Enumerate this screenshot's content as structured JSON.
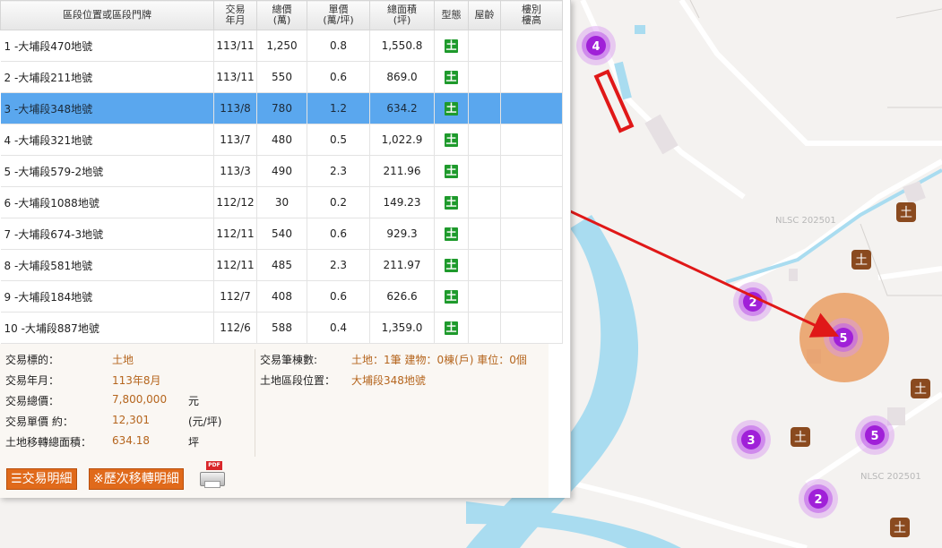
{
  "table": {
    "headers": {
      "address": "區段位置或區段門牌",
      "date_line1": "交易",
      "date_line2": "年月",
      "total_line1": "總價",
      "total_line2": "(萬)",
      "unit_line1": "單價",
      "unit_line2": "(萬/坪)",
      "area_line1": "總面積",
      "area_line2": "(坪)",
      "type": "型態",
      "age": "屋齡",
      "floor_line1": "樓別",
      "floor_line2": "樓高"
    },
    "rows": [
      {
        "address": "1 -大埔段470地號",
        "date": "113/11",
        "total": "1,250",
        "unit": "0.8",
        "area": "1,550.8",
        "type": "土"
      },
      {
        "address": "2 -大埔段211地號",
        "date": "113/11",
        "total": "550",
        "unit": "0.6",
        "area": "869.0",
        "type": "土"
      },
      {
        "address": "3 -大埔段348地號",
        "date": "113/8",
        "total": "780",
        "unit": "1.2",
        "area": "634.2",
        "type": "土"
      },
      {
        "address": "4 -大埔段321地號",
        "date": "113/7",
        "total": "480",
        "unit": "0.5",
        "area": "1,022.9",
        "type": "土"
      },
      {
        "address": "5 -大埔段579-2地號",
        "date": "113/3",
        "total": "490",
        "unit": "2.3",
        "area": "211.96",
        "type": "土"
      },
      {
        "address": "6 -大埔段1088地號",
        "date": "112/12",
        "total": "30",
        "unit": "0.2",
        "area": "149.23",
        "type": "土"
      },
      {
        "address": "7 -大埔段674-3地號",
        "date": "112/11",
        "total": "540",
        "unit": "0.6",
        "area": "929.3",
        "type": "土"
      },
      {
        "address": "8 -大埔段581地號",
        "date": "112/11",
        "total": "485",
        "unit": "2.3",
        "area": "211.97",
        "type": "土"
      },
      {
        "address": "9 -大埔段184地號",
        "date": "112/7",
        "total": "408",
        "unit": "0.6",
        "area": "626.6",
        "type": "土"
      },
      {
        "address": "10 -大埔段887地號",
        "date": "112/6",
        "total": "588",
        "unit": "0.4",
        "area": "1,359.0",
        "type": "土"
      }
    ]
  },
  "details": {
    "target_label": "交易標的：",
    "target_value": "土地",
    "date_label": "交易年月：",
    "date_value": "113年8月",
    "total_label": "交易總價：",
    "total_value": "7,800,000",
    "total_unit": "元",
    "unit_label": "交易單價 約：",
    "unit_value": "12,301",
    "unit_unit": "(元/坪)",
    "area_label": "土地移轉總面積：",
    "area_value": "634.18",
    "area_unit": "坪",
    "count_label": "交易筆棟數:",
    "count_value": "土地：1筆 建物：0棟(戶) 車位：0個",
    "location_label": "土地區段位置：",
    "location_value": "大埔段348地號"
  },
  "buttons": {
    "detail": "交易明細",
    "history": "※歷次移轉明細",
    "print_icon_badge": "PDF"
  },
  "map": {
    "watermark_1": "NLSC 202501",
    "watermark_2": "NLSC 202501",
    "clusters": [
      {
        "id": "a",
        "count": "4"
      },
      {
        "id": "b",
        "count": "2"
      },
      {
        "id": "c",
        "count": "5"
      },
      {
        "id": "d",
        "count": "3"
      },
      {
        "id": "e",
        "count": "5"
      },
      {
        "id": "f",
        "count": "2"
      }
    ],
    "land_marker_glyph": "土"
  },
  "colors": {
    "selected_row": "#5aa7ee",
    "type_badge": "#1e9a2c",
    "detail_value": "#b5651d",
    "button": "#e06a1b",
    "cluster": "#a020d8",
    "arrow": "#e01818",
    "water": "#a9dcf0"
  }
}
